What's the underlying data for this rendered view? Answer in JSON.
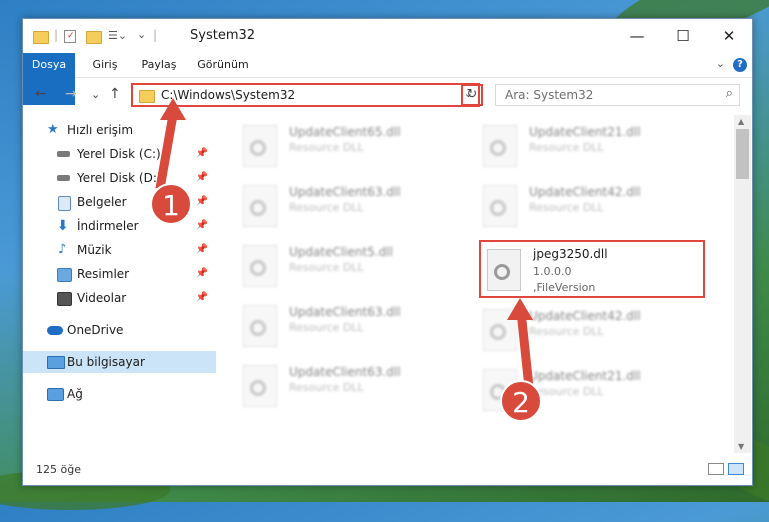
{
  "window": {
    "title": "System32",
    "controls": {
      "minimize": "—",
      "maximize": "☐",
      "close": "✕"
    }
  },
  "ribbon": {
    "tabs": [
      "Dosya",
      "Giriş",
      "Paylaş",
      "Görünüm"
    ],
    "help": "?",
    "expand": "⌄"
  },
  "navbar": {
    "back": "←",
    "forward": "→",
    "recent": "⌄",
    "up": "↑",
    "address": "C:\\Windows\\System32",
    "address_dropdown": "⌄",
    "refresh": "↻",
    "search_placeholder": "Ara: System32",
    "search_icon": "⌕"
  },
  "sidebar": {
    "items": [
      {
        "label": "Hızlı erişim",
        "icon": "star-icon",
        "pinned": false
      },
      {
        "label": "Yerel Disk (C:)",
        "icon": "drive-icon",
        "pinned": true
      },
      {
        "label": "Yerel Disk (D:)",
        "icon": "drive-icon",
        "pinned": true
      },
      {
        "label": "Belgeler",
        "icon": "documents-icon",
        "pinned": true
      },
      {
        "label": "İndirmeler",
        "icon": "download-icon",
        "pinned": true
      },
      {
        "label": "Müzik",
        "icon": "music-icon",
        "pinned": true
      },
      {
        "label": "Resimler",
        "icon": "pictures-icon",
        "pinned": true
      },
      {
        "label": "Videolar",
        "icon": "videos-icon",
        "pinned": true
      },
      {
        "label": "OneDrive",
        "icon": "cloud-icon",
        "pinned": false
      },
      {
        "label": "Bu bilgisayar",
        "icon": "computer-icon",
        "pinned": false,
        "selected": true
      },
      {
        "label": "Ağ",
        "icon": "network-icon",
        "pinned": false
      }
    ],
    "pin_glyph": "📌"
  },
  "files": [
    {
      "name": "UpdateClient65.dll",
      "desc": "Resource DLL"
    },
    {
      "name": "UpdateClient21.dll",
      "desc": "Resource DLL"
    },
    {
      "name": "UpdateClient63.dll",
      "desc": "Resource DLL"
    },
    {
      "name": "UpdateClient42.dll",
      "desc": "Resource DLL"
    },
    {
      "name": "UpdateClient5.dll",
      "desc": "Resource DLL"
    },
    {
      "name": "jpeg3250.dll",
      "desc": "1.0.0.0",
      "desc2": ",FileVersion",
      "highlight": true
    },
    {
      "name": "UpdateClient63.dll",
      "desc": "Resource DLL"
    },
    {
      "name": "UpdateClient42.dll",
      "desc": "Resource DLL"
    },
    {
      "name": "UpdateClient63.dll",
      "desc": "Resource DLL"
    },
    {
      "name": "UpdateClient21.dll",
      "desc": "Resource DLL"
    }
  ],
  "status": {
    "count": "125 öğe"
  },
  "annotations": {
    "marker1": "1",
    "marker2": "2",
    "color": "#d84a3c"
  }
}
